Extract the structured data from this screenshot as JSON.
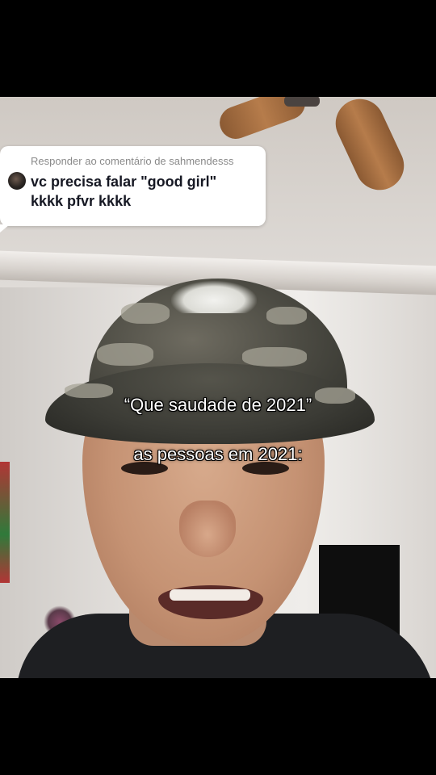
{
  "reply": {
    "header": "Responder ao comentário de sahmendesss",
    "line1": "vc precisa falar \"good girl\"",
    "line2": "kkkk pfvr kkkk"
  },
  "captions": {
    "line1": "“Que saudade de 2021”",
    "line2": "as pessoas em 2021:"
  },
  "colors": {
    "letterbox": "#000000",
    "bubble": "#ffffff",
    "comment_text": "#161823",
    "header_text": "#8a8a8a",
    "caption_text": "#ffffff"
  },
  "icons": {
    "avatar": "commenter-avatar"
  }
}
